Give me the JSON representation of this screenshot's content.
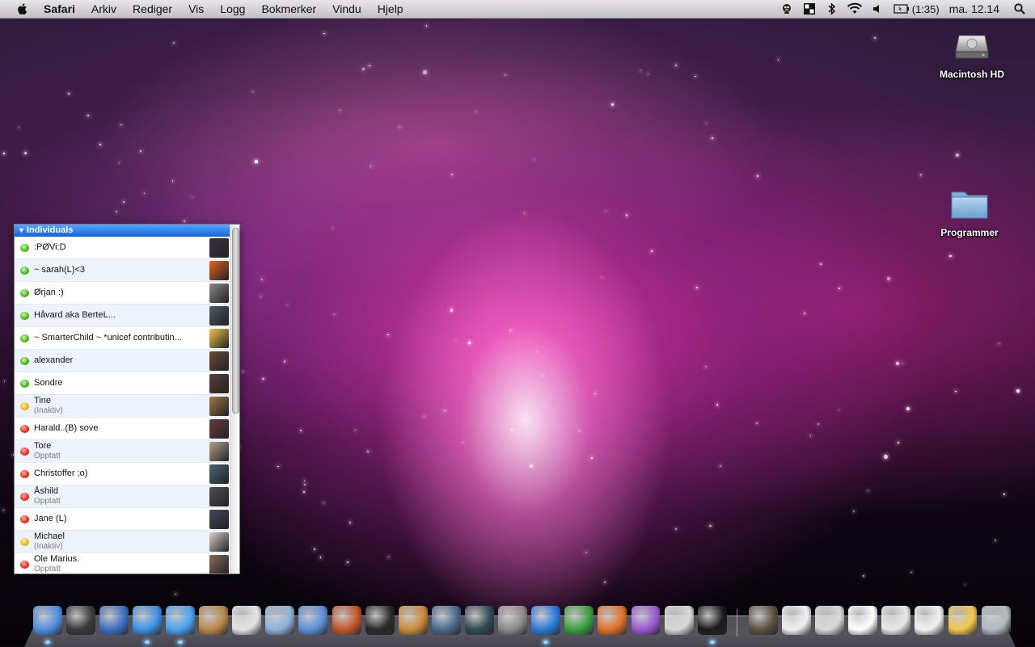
{
  "menubar": {
    "app_name": "Safari",
    "menus": [
      "Arkiv",
      "Rediger",
      "Vis",
      "Logg",
      "Bokmerker",
      "Vindu",
      "Hjelp"
    ],
    "battery_text": "(1:35)",
    "clock": "ma. 12.14",
    "status_icons": [
      "adium-duck-icon",
      "spaces-icon",
      "bluetooth-icon",
      "wifi-icon",
      "volume-icon"
    ]
  },
  "desktop": {
    "icons": [
      {
        "label": "Macintosh HD",
        "icon": "hard-drive-icon"
      },
      {
        "label": "Programmer",
        "icon": "folder-icon"
      }
    ]
  },
  "buddy_list": {
    "group": "Individuals",
    "buddies": [
      {
        "name": ":PØVi:D",
        "status": "",
        "state": "online",
        "avatar": "#3a3040"
      },
      {
        "name": "~ sarah(L)<3",
        "status": "",
        "state": "online",
        "avatar": "#e8621c"
      },
      {
        "name": "Ørjan :)",
        "status": "",
        "state": "online",
        "avatar": "#8c8a86"
      },
      {
        "name": "Håvard aka BerteL...",
        "status": "",
        "state": "online",
        "avatar": "#4a5968"
      },
      {
        "name": "~ SmarterChild ~ *unicef contributin...",
        "status": "",
        "state": "online",
        "avatar": "#f2c44a"
      },
      {
        "name": "alexander",
        "status": "",
        "state": "online",
        "avatar": "#6a4a3a"
      },
      {
        "name": "Sondre",
        "status": "",
        "state": "online",
        "avatar": "#5a4038"
      },
      {
        "name": "Tine",
        "status": "(Inaktiv)",
        "state": "idle",
        "avatar": "#a07848"
      },
      {
        "name": "Harald..(B) sove",
        "status": "",
        "state": "busy",
        "avatar": "#6a3a3a"
      },
      {
        "name": "Tore",
        "status": "Opptatt",
        "state": "busy",
        "avatar": "#b6a48c"
      },
      {
        "name": "Christoffer ;o)",
        "status": "",
        "state": "busy",
        "avatar": "#4a6478"
      },
      {
        "name": "Åshild",
        "status": "Opptatt",
        "state": "busy",
        "avatar": "#505050"
      },
      {
        "name": "Jane (L)",
        "status": "",
        "state": "busy",
        "avatar": "#3c4a5a"
      },
      {
        "name": "Michael",
        "status": "(Inaktiv)",
        "state": "idle",
        "avatar": "#d8d2c8"
      },
      {
        "name": "Ole Marius.",
        "status": "Opptatt",
        "state": "busy",
        "avatar": "#8a6a58"
      }
    ]
  },
  "dock": {
    "items": [
      {
        "name": "finder",
        "color": "#4f8fe0"
      },
      {
        "name": "dashboard",
        "color": "#3a3a3a"
      },
      {
        "name": "mail",
        "color": "#3d6fbf"
      },
      {
        "name": "safari",
        "color": "#3b8fe6"
      },
      {
        "name": "ichat",
        "color": "#4aa0f0"
      },
      {
        "name": "address-book",
        "color": "#b8864a"
      },
      {
        "name": "ical",
        "color": "#e4e4e4"
      },
      {
        "name": "iphoto",
        "color": "#8fb0d8"
      },
      {
        "name": "itunes",
        "color": "#5a8fd8"
      },
      {
        "name": "photo-booth",
        "color": "#c0562a"
      },
      {
        "name": "imovie",
        "color": "#2a2a2a"
      },
      {
        "name": "garageband",
        "color": "#c88a3a"
      },
      {
        "name": "spaces",
        "color": "#4a6a8a"
      },
      {
        "name": "time-machine",
        "color": "#2e4a50"
      },
      {
        "name": "system-preferences",
        "color": "#8a8a8a"
      },
      {
        "name": "word",
        "color": "#2a7ad8"
      },
      {
        "name": "excel",
        "color": "#3aa040"
      },
      {
        "name": "powerpoint",
        "color": "#e0702a"
      },
      {
        "name": "entourage",
        "color": "#9a5ad0"
      },
      {
        "name": "textedit",
        "color": "#d8d8d8"
      },
      {
        "name": "adium",
        "color": "#1a1a1a"
      },
      {
        "name": "separator",
        "color": ""
      },
      {
        "name": "downloads-stack",
        "color": "#5a5040"
      },
      {
        "name": "rtf-document",
        "color": "#f0f0f0"
      },
      {
        "name": "image-stack",
        "color": "#d8d8d8"
      },
      {
        "name": "word-document",
        "color": "#ffffff"
      },
      {
        "name": "screenshot-document",
        "color": "#e8e8e8"
      },
      {
        "name": "window-document",
        "color": "#f2f2f2"
      },
      {
        "name": "smarterchild-stack",
        "color": "#f2c44a"
      },
      {
        "name": "trash",
        "color": "#b0b8c0"
      }
    ]
  }
}
